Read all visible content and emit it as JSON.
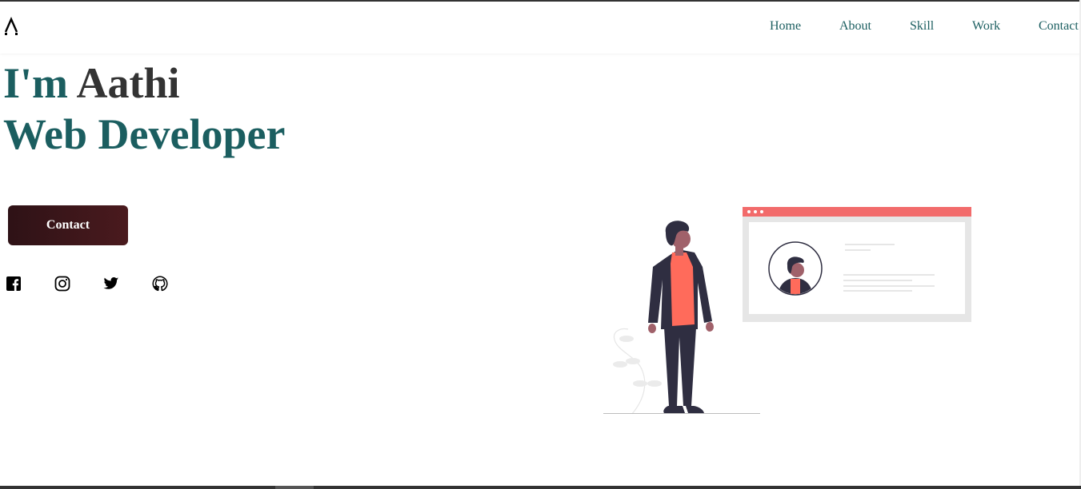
{
  "brand": {
    "logo_text": "A"
  },
  "nav": {
    "items": [
      {
        "label": "Home"
      },
      {
        "label": "About"
      },
      {
        "label": "Skill"
      },
      {
        "label": "Work"
      },
      {
        "label": "Contact"
      }
    ]
  },
  "hero": {
    "title_prefix": "I'm ",
    "title_name": "Aathi",
    "subtitle": "Web Developer",
    "cta_label": "Contact"
  },
  "social": [
    {
      "icon": "facebook-icon"
    },
    {
      "icon": "instagram-icon"
    },
    {
      "icon": "twitter-icon"
    },
    {
      "icon": "github-icon"
    }
  ],
  "colors": {
    "accent": "#1b5e60",
    "text_dark": "#333333",
    "button_dark": "#2e1216",
    "browser_bar": "#f26b6b",
    "person_shirt": "#ff6b5b",
    "person_suit": "#2f2e41"
  }
}
